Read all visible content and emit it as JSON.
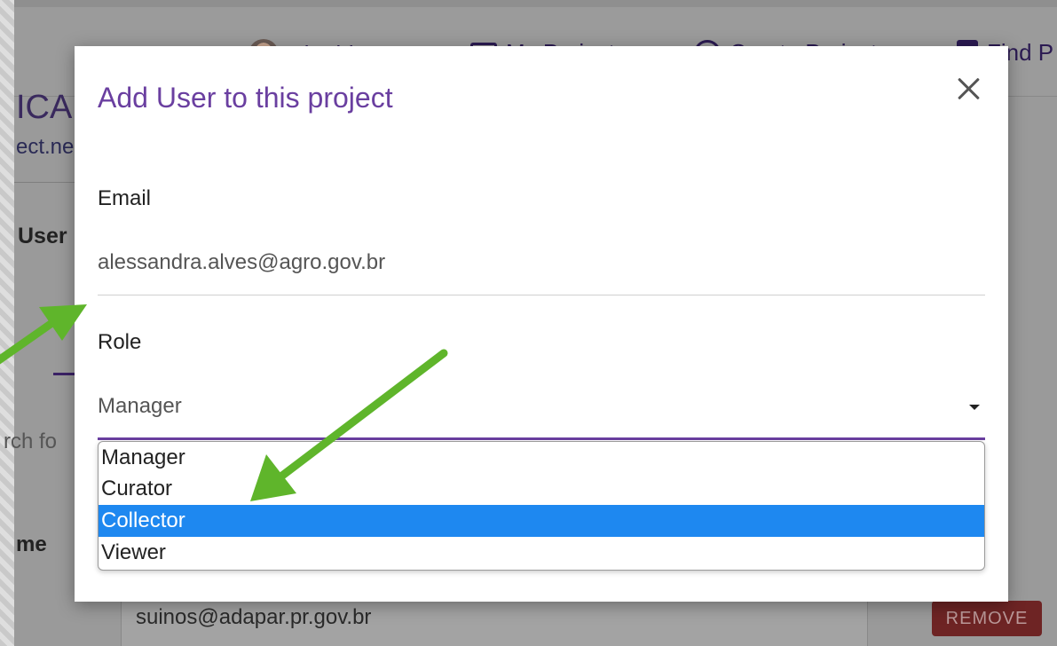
{
  "background": {
    "nav": {
      "greeting": "Hi, Thiago",
      "my_projects": "My Projects",
      "create_project": "Create Project",
      "find": "Find P"
    },
    "partial_texts": {
      "title_fragment": "ICA",
      "url_fragment": "ect.ne",
      "users_tab": "User",
      "search_fragment": "rch fo",
      "name_header": "me"
    },
    "user_row": {
      "email": "suinos@adapar.pr.gov.br",
      "remove_label": "REMOVE"
    }
  },
  "modal": {
    "title": "Add User to this project",
    "email_label": "Email",
    "email_value": "alessandra.alves@agro.gov.br",
    "role_label": "Role",
    "role_value": "Manager",
    "role_options": [
      {
        "label": "Manager"
      },
      {
        "label": "Curator"
      },
      {
        "label": "Collector"
      },
      {
        "label": "Viewer"
      }
    ],
    "selected_option": "Collector"
  },
  "colors": {
    "accent_purple": "#6a3fa0",
    "selected_blue": "#1e88f0",
    "annotation_green": "#5fb52b",
    "remove_red": "#6e2424"
  }
}
